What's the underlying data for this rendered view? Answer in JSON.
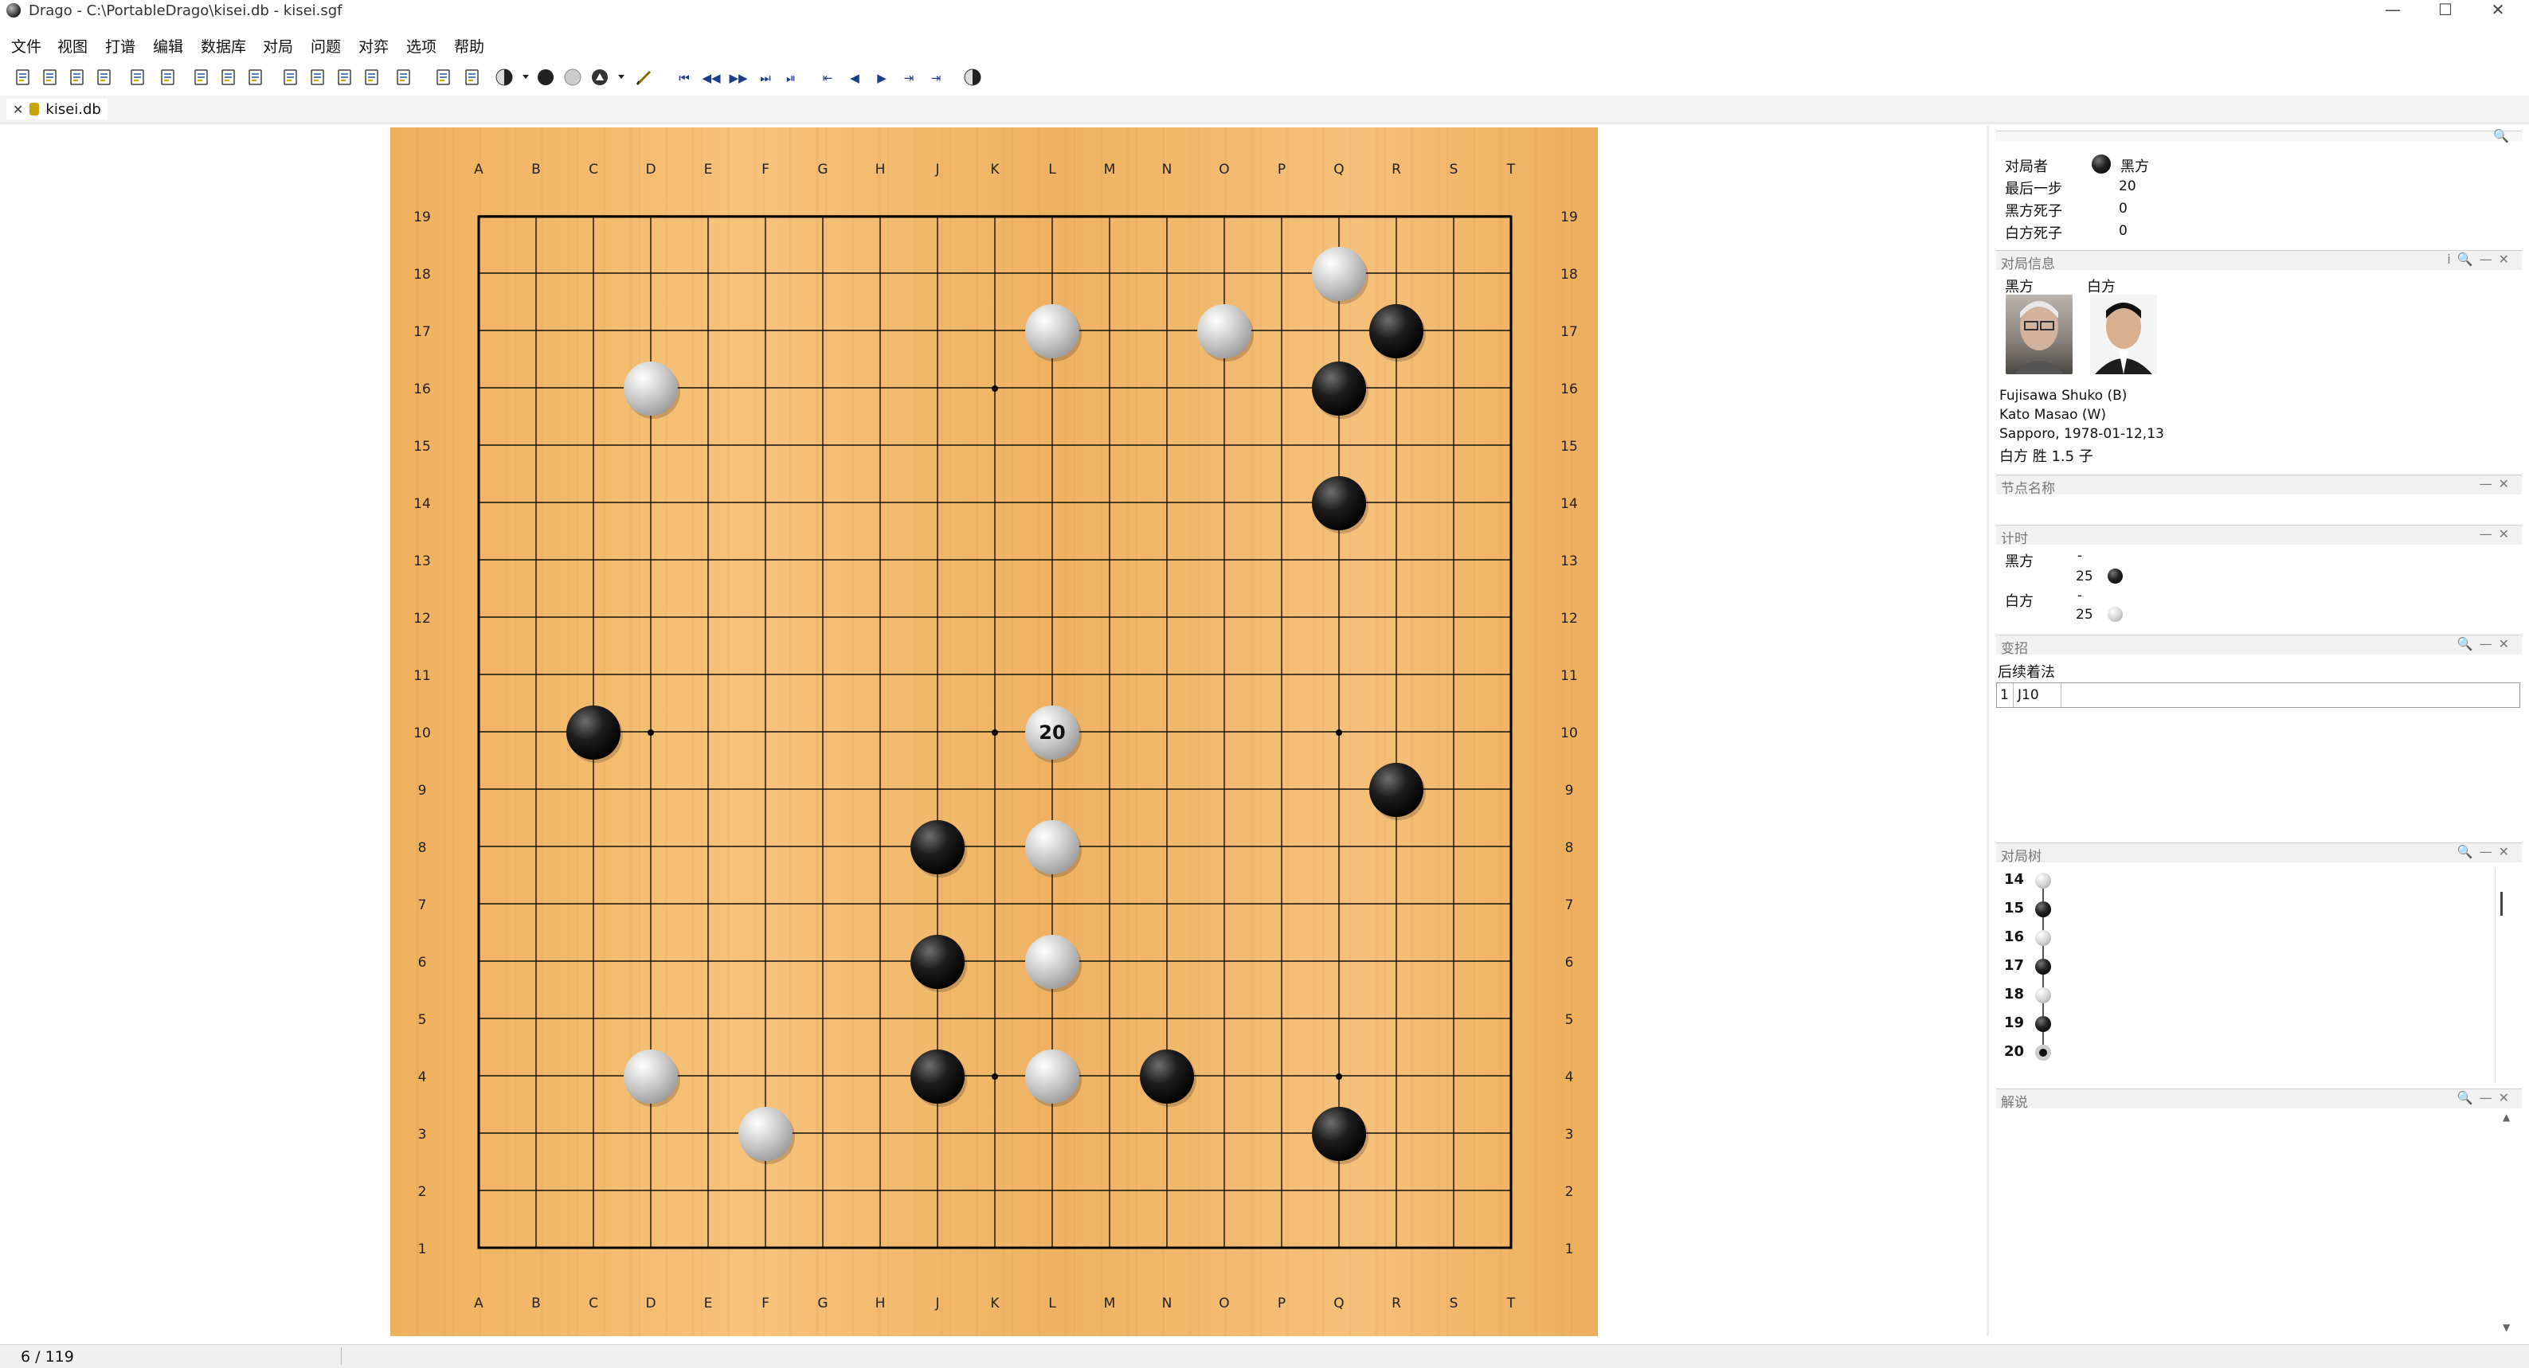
{
  "window": {
    "title": "Drago - C:\\PortableDrago\\kisei.db - kisei.sgf",
    "min_glyph": "—",
    "max_glyph": "☐",
    "close_glyph": "✕"
  },
  "menu": [
    "文件",
    "视图",
    "打谱",
    "编辑",
    "数据库",
    "对局",
    "问题",
    "对弈",
    "选项",
    "帮助"
  ],
  "toolbar": [
    "new-file-icon",
    "open-file-icon",
    "save-icon",
    "print-icon",
    "open-folder-icon",
    "tools-icon",
    "game-list-icon",
    "game-list-edit-icon",
    "game-list-check-icon",
    "new-game-icon",
    "open-game-icon",
    "search-game-icon",
    "search-pattern-icon",
    "settings-icon",
    "undo-icon",
    "branch-icon",
    "play-mode-icon",
    "dropdown-icon",
    "black-stone-icon",
    "white-stone-icon",
    "stone-mark-icon",
    "dropdown-icon",
    "pen-icon",
    "first-move-icon",
    "fast-back-icon",
    "fast-forward-icon",
    "last-move-icon",
    "end-icon",
    "prev-variation-icon",
    "back-icon",
    "forward-icon",
    "next-variation-icon",
    "end-variation-icon",
    "engine-icon"
  ],
  "tab": {
    "label": "kisei.db",
    "close": "✕"
  },
  "board": {
    "size": 19,
    "columns": [
      "A",
      "B",
      "C",
      "D",
      "E",
      "F",
      "G",
      "H",
      "J",
      "K",
      "L",
      "M",
      "N",
      "O",
      "P",
      "Q",
      "R",
      "S",
      "T"
    ],
    "rows": [
      "19",
      "18",
      "17",
      "16",
      "15",
      "14",
      "13",
      "12",
      "11",
      "10",
      "9",
      "8",
      "7",
      "6",
      "5",
      "4",
      "3",
      "2",
      "1"
    ],
    "hoshi": [
      "D16",
      "K16",
      "Q16",
      "D10",
      "K10",
      "Q10",
      "D4",
      "K4",
      "Q4"
    ],
    "stones": [
      {
        "pt": "Q18",
        "color": "white"
      },
      {
        "pt": "L17",
        "color": "white"
      },
      {
        "pt": "O17",
        "color": "white"
      },
      {
        "pt": "R17",
        "color": "black"
      },
      {
        "pt": "D16",
        "color": "white"
      },
      {
        "pt": "Q16",
        "color": "black"
      },
      {
        "pt": "Q14",
        "color": "black"
      },
      {
        "pt": "C10",
        "color": "black"
      },
      {
        "pt": "L10",
        "color": "white",
        "label": "20"
      },
      {
        "pt": "R9",
        "color": "black"
      },
      {
        "pt": "J8",
        "color": "black"
      },
      {
        "pt": "L8",
        "color": "white"
      },
      {
        "pt": "J6",
        "color": "black"
      },
      {
        "pt": "L6",
        "color": "white"
      },
      {
        "pt": "D4",
        "color": "white"
      },
      {
        "pt": "J4",
        "color": "black"
      },
      {
        "pt": "L4",
        "color": "white"
      },
      {
        "pt": "N4",
        "color": "black"
      },
      {
        "pt": "F3",
        "color": "white"
      },
      {
        "pt": "Q3",
        "color": "black"
      }
    ]
  },
  "status_panel": {
    "player_label": "对局者",
    "player_value": "黑方",
    "last_move_label": "最后一步",
    "last_move_value": "20",
    "black_captures_label": "黑方死子",
    "black_captures_value": "0",
    "white_captures_label": "白方死子",
    "white_captures_value": "0"
  },
  "game_info": {
    "title": "对局信息",
    "black_label": "黑方",
    "white_label": "白方",
    "black_player": "Fujisawa Shuko  (B)",
    "white_player": "Kato Masao  (W)",
    "place_date": "Sapporo, 1978-01-12,13",
    "result": "白方 胜 1.5 子"
  },
  "node_name": {
    "title": "节点名称"
  },
  "timing": {
    "title": "计时",
    "black_label": "黑方",
    "black_dash": "-",
    "black_time": "25",
    "white_label": "白方",
    "white_dash": "-",
    "white_time": "25"
  },
  "variations": {
    "title": "变招",
    "next_moves_label": "后续着法",
    "move_index": "1",
    "move_value": "J10"
  },
  "game_tree": {
    "title": "对局树",
    "nodes": [
      {
        "num": "14",
        "color": "white"
      },
      {
        "num": "15",
        "color": "black"
      },
      {
        "num": "16",
        "color": "white"
      },
      {
        "num": "17",
        "color": "black"
      },
      {
        "num": "18",
        "color": "white"
      },
      {
        "num": "19",
        "color": "black"
      },
      {
        "num": "20",
        "color": "white",
        "current": true
      }
    ]
  },
  "comments": {
    "title": "解说"
  },
  "statusbar": {
    "position": "6 / 119"
  },
  "colors": {
    "board": "#f2b665",
    "line": "#111111"
  }
}
